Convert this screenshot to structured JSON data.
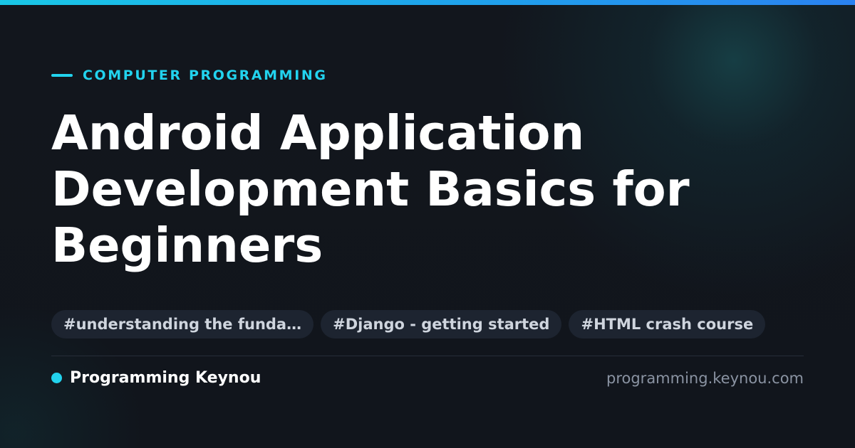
{
  "colors": {
    "accent": "#22d3ee",
    "background": "#11151c",
    "tag_background": "#1d2430",
    "url_text": "#8a93a2"
  },
  "eyebrow": {
    "label": "COMPUTER PROGRAMMING"
  },
  "title": "Android Application Development Basics for Beginners",
  "tags": [
    "#understanding the funda…",
    "#Django - getting started",
    "#HTML crash course"
  ],
  "footer": {
    "brand": "Programming Keynou",
    "url": "programming.keynou.com"
  }
}
